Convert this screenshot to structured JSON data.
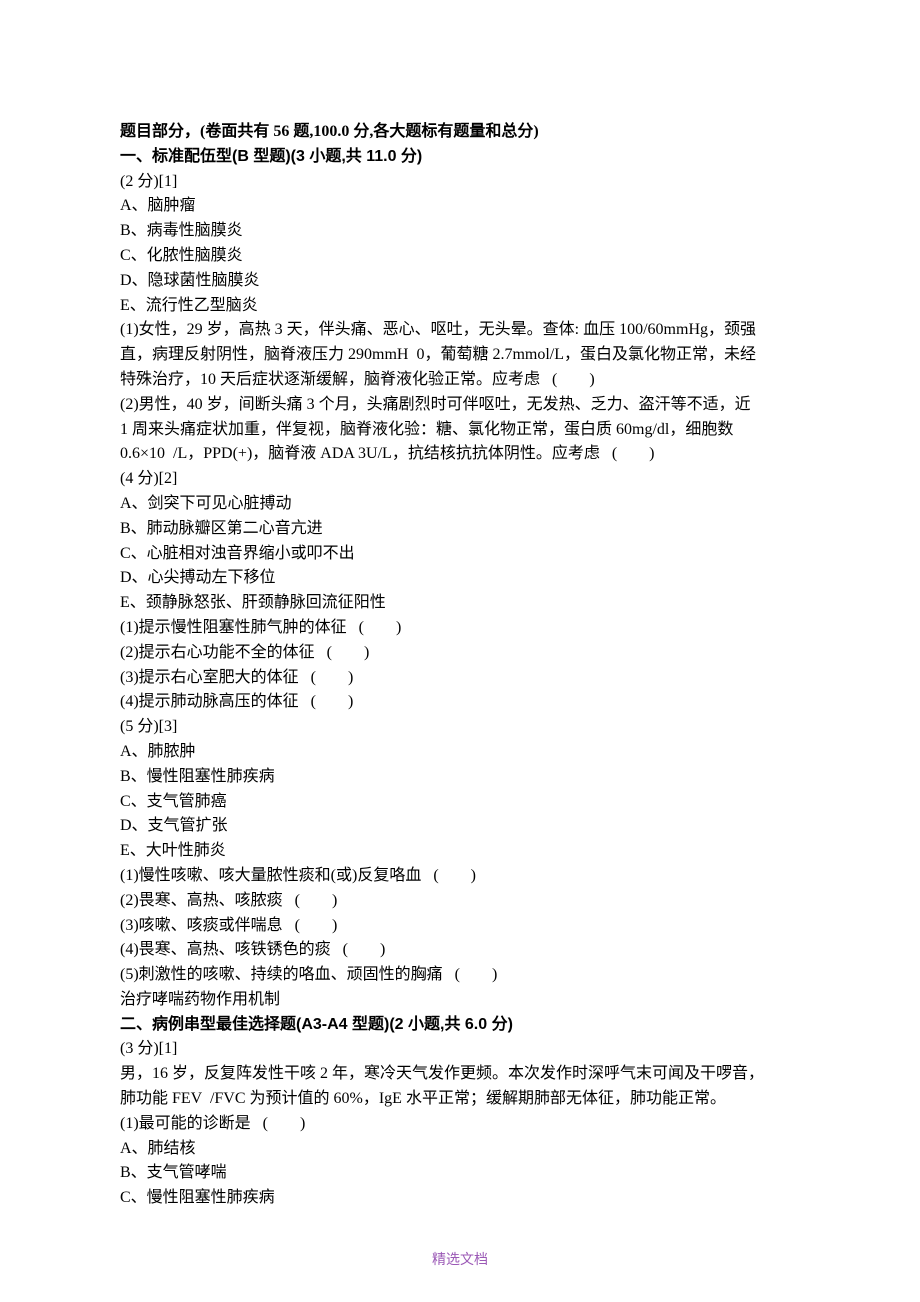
{
  "header": "题目部分，(卷面共有 56 题,100.0 分,各大题标有题量和总分)",
  "section1": {
    "title": "一、标准配伍型(B 型题)(3 小题,共 11.0 分)",
    "q1": {
      "score": "(2 分)[1]",
      "optA": "A、脑肿瘤",
      "optB": "B、病毒性脑膜炎",
      "optC": "C、化脓性脑膜炎",
      "optD": "D、隐球菌性脑膜炎",
      "optE": "E、流行性乙型脑炎",
      "sub1a": "(1)女性，29 岁，高热 3 天，伴头痛、恶心、呕吐，无头晕。查体: 血压 100/60mmHg，颈强",
      "sub1b": "直，病理反射阴性，脑脊液压力 290mmH  0，葡萄糖 2.7mmol/L，蛋白及氯化物正常，未经",
      "sub1c": "特殊治疗，10 天后症状逐渐缓解，脑脊液化验正常。应考虑   (        )",
      "sub2a": "(2)男性，40 岁，间断头痛 3 个月，头痛剧烈时可伴呕吐，无发热、乏力、盗汗等不适，近",
      "sub2b": "1 周来头痛症状加重，伴复视，脑脊液化验：糖、氯化物正常，蛋白质 60mg/dl，细胞数",
      "sub2c": "0.6×10  /L，PPD(+)，脑脊液 ADA 3U/L，抗结核抗抗体阴性。应考虑   (        )"
    },
    "q2": {
      "score": "(4 分)[2]",
      "optA": "A、剑突下可见心脏搏动",
      "optB": "B、肺动脉瓣区第二心音亢进",
      "optC": "C、心脏相对浊音界缩小或叩不出",
      "optD": "D、心尖搏动左下移位",
      "optE": "E、颈静脉怒张、肝颈静脉回流征阳性",
      "sub1": "(1)提示慢性阻塞性肺气肿的体征   (        )",
      "sub2": "(2)提示右心功能不全的体征   (        )",
      "sub3": "(3)提示右心室肥大的体征   (        )",
      "sub4": "(4)提示肺动脉高压的体征   (        )"
    },
    "q3": {
      "score": "(5 分)[3]",
      "optA": "A、肺脓肿",
      "optB": "B、慢性阻塞性肺疾病",
      "optC": "C、支气管肺癌",
      "optD": "D、支气管扩张",
      "optE": "E、大叶性肺炎",
      "sub1": "(1)慢性咳嗽、咳大量脓性痰和(或)反复咯血   (        )",
      "sub2": "(2)畏寒、高热、咳脓痰   (        )",
      "sub3": "(3)咳嗽、咳痰或伴喘息   (        )",
      "sub4": "(4)畏寒、高热、咳铁锈色的痰   (        )",
      "sub5": "(5)刺激性的咳嗽、持续的咯血、顽固性的胸痛   (        )",
      "note": "治疗哮喘药物作用机制"
    }
  },
  "section2": {
    "title": "二、病例串型最佳选择题(A3-A4 型题)(2 小题,共 6.0 分)",
    "q1": {
      "score": "(3 分)[1]",
      "stem1": "男，16 岁，反复阵发性干咳 2 年，寒冷天气发作更频。本次发作时深呼气末可闻及干啰音，",
      "stem2": "肺功能 FEV  /FVC 为预计值的 60%，IgE 水平正常；缓解期肺部无体征，肺功能正常。",
      "sub1": "(1)最可能的诊断是   (        )",
      "optA": "A、肺结核",
      "optB": "B、支气管哮喘",
      "optC": "C、慢性阻塞性肺疾病"
    }
  },
  "footer": "精选文档"
}
